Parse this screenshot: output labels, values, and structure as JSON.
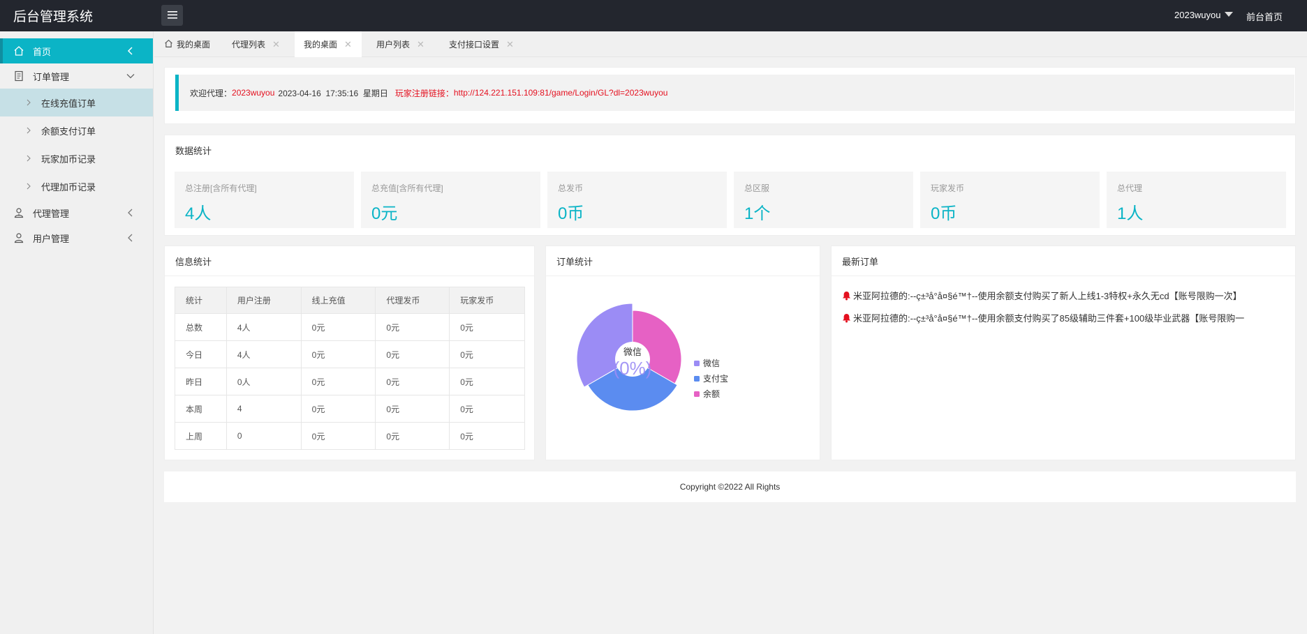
{
  "header": {
    "brand": "后台管理系统",
    "user": "2023wuyou",
    "front_link": "前台首页"
  },
  "sidebar": {
    "items": [
      {
        "label": "首页",
        "icon": "home-icon"
      },
      {
        "label": "订单管理",
        "icon": "document-icon"
      },
      {
        "label": "代理管理",
        "icon": "agents-icon"
      },
      {
        "label": "用户管理",
        "icon": "user-icon"
      }
    ],
    "sub_items": [
      "在线充值订单",
      "余额支付订单",
      "玩家加币记录",
      "代理加币记录"
    ]
  },
  "tabs": [
    {
      "label": "我的桌面"
    },
    {
      "label": "代理列表",
      "close": "✕"
    },
    {
      "label": "我的桌面",
      "close": "✕"
    },
    {
      "label": "用户列表",
      "close": "✕"
    },
    {
      "label": "支付接口设置",
      "close": "✕"
    }
  ],
  "welcome": {
    "prefix": "欢迎代理：",
    "agent": "2023wuyou",
    "datetime": "2023-04-16  17:35:16  星期日",
    "link_label": "玩家注册链接：",
    "link_url": "http://124.221.151.109:81/game/Login/GL?dl=2023wuyou"
  },
  "data_stats": {
    "title": "数据统计",
    "cards": [
      {
        "label": "总注册[含所有代理]",
        "value": "4人"
      },
      {
        "label": "总充值[含所有代理]",
        "value": "0元"
      },
      {
        "label": "总发币",
        "value": "0币"
      },
      {
        "label": "总区服",
        "value": "1个"
      },
      {
        "label": "玩家发币",
        "value": "0币"
      },
      {
        "label": "总代理",
        "value": "1人"
      }
    ]
  },
  "info_stats": {
    "title": "信息统计",
    "columns": [
      "统计",
      "用户注册",
      "线上充值",
      "代理发币",
      "玩家发币"
    ],
    "rows": [
      [
        "总数",
        "4人",
        "0元",
        "0元",
        "0元"
      ],
      [
        "今日",
        "4人",
        "0元",
        "0元",
        "0元"
      ],
      [
        "昨日",
        "0人",
        "0元",
        "0元",
        "0元"
      ],
      [
        "本周",
        "4",
        "0元",
        "0元",
        "0元"
      ],
      [
        "上周",
        "0",
        "0元",
        "0元",
        "0元"
      ]
    ]
  },
  "order_stats": {
    "title": "订单统计",
    "center_label": "微信",
    "center_value": "(0%)",
    "legend": [
      {
        "label": "微信",
        "color": "#9b8cf5"
      },
      {
        "label": "支付宝",
        "color": "#5b8cf0"
      },
      {
        "label": "余额",
        "color": "#e661c4"
      }
    ]
  },
  "chart_data": {
    "type": "pie",
    "categories": [
      "微信",
      "支付宝",
      "余额"
    ],
    "values": [
      1,
      1,
      1
    ],
    "colors": [
      "#9b8cf5",
      "#5b8cf0",
      "#e661c4"
    ],
    "legend_position": "right"
  },
  "latest_orders": {
    "title": "最新订单",
    "items": [
      "米亚阿拉德的:--ç±³å°å¤§é™†--使用余额支付购买了新人上线1-3特权+永久无cd【账号限购一次】",
      "米亚阿拉德的:--ç±³å°å¤§é™†--使用余额支付购买了85级辅助三件套+100级毕业武器【账号限购一"
    ]
  },
  "footer": {
    "copyright": "Copyright ©2022 All Rights"
  }
}
